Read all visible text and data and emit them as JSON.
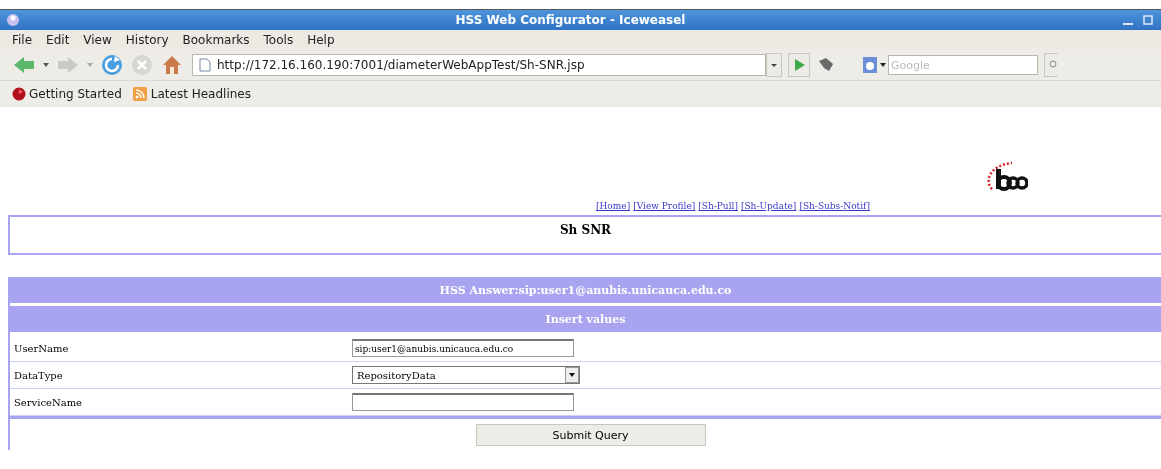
{
  "window": {
    "title": "HSS Web Configurator - Iceweasel"
  },
  "menu": [
    "File",
    "Edit",
    "View",
    "History",
    "Bookmarks",
    "Tools",
    "Help"
  ],
  "toolbar": {
    "url": "http://172.16.160.190:7001/diameterWebAppTest/Sh-SNR.jsp",
    "search_placeholder": "Google"
  },
  "bookmarks": [
    "Getting Started",
    "Latest Headlines"
  ],
  "page": {
    "nav_links": [
      "[Home]",
      "[View Profile]",
      "[Sh-Pull]",
      "[Sh-Update]",
      "[Sh-Subs-Notif]"
    ],
    "heading": "Sh SNR",
    "answer": "HSS Answer:sip:user1@anubis.unicauca.edu.co",
    "section": "Insert values",
    "fields": [
      {
        "label": "UserName",
        "kind": "text",
        "value": "sip:user1@anubis.unicauca.edu.co"
      },
      {
        "label": "DataType",
        "kind": "select",
        "value": "RepositoryData"
      },
      {
        "label": "ServiceName",
        "kind": "text"
      }
    ],
    "submit": "Submit Query"
  }
}
